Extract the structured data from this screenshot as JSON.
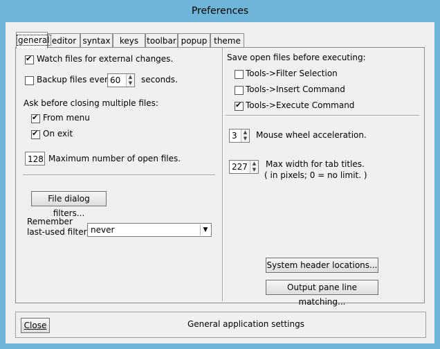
{
  "window": {
    "title": "Preferences"
  },
  "tabs": [
    {
      "label": "general",
      "active": true
    },
    {
      "label": "editor"
    },
    {
      "label": "syntax"
    },
    {
      "label": "keys"
    },
    {
      "label": "toolbar"
    },
    {
      "label": "popup"
    },
    {
      "label": "theme"
    }
  ],
  "general": {
    "watch_files_label": "Watch files for external changes.",
    "watch_files_checked": true,
    "backup_label": "Backup files every",
    "backup_checked": false,
    "backup_value": "60",
    "backup_unit": "seconds.",
    "ask_before_closing_label": "Ask before closing multiple files:",
    "from_menu_label": "From menu",
    "from_menu_checked": true,
    "on_exit_label": "On exit",
    "on_exit_checked": true,
    "max_open_value": "128",
    "max_open_label": "Maximum number of open files.",
    "file_dialog_filters_label": "File dialog filters...",
    "remember_label_line1": "Remember",
    "remember_label_line2": "last-used filter :",
    "remember_value": "never"
  },
  "executing": {
    "heading": "Save open files before executing:",
    "items": [
      {
        "label": "Tools->Filter Selection",
        "checked": false
      },
      {
        "label": "Tools->Insert Command",
        "checked": false
      },
      {
        "label": "Tools->Execute Command",
        "checked": true
      }
    ]
  },
  "mouse_wheel": {
    "value": "3",
    "label": "Mouse wheel acceleration."
  },
  "tab_width": {
    "value": "227",
    "label": "Max width for tab titles.",
    "note": "( in pixels;  0 = no limit. )"
  },
  "buttons": {
    "system_header": "System header locations...",
    "output_pane": "Output pane line matching..."
  },
  "footer": {
    "close_label": "Close",
    "status_text": "General application settings"
  }
}
